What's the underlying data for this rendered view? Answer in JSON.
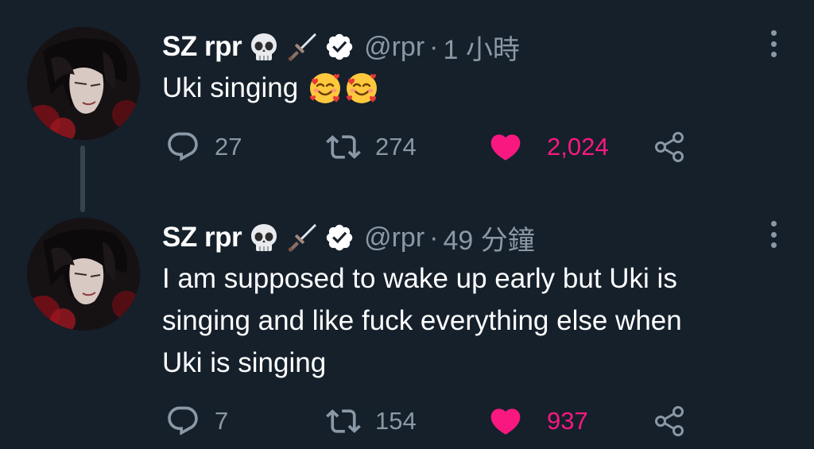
{
  "colors": {
    "background": "#15202b",
    "text_primary": "#ffffff",
    "text_secondary": "#8b98a5",
    "like_active": "#f91880",
    "thread_line": "#38444d"
  },
  "tweets": [
    {
      "display_name": "SZ rpr",
      "name_emojis": [
        "skull-emoji",
        "dagger-emoji"
      ],
      "verified": true,
      "handle": "@rpr",
      "separator": "·",
      "time": "1 小時",
      "text_lines": [
        "Uki singing"
      ],
      "text_emojis": [
        "smiling-face-with-hearts-emoji",
        "smiling-face-with-hearts-emoji"
      ],
      "reply_count": "27",
      "retweet_count": "274",
      "like_count": "2,024",
      "liked": true
    },
    {
      "display_name": "SZ rpr",
      "name_emojis": [
        "skull-emoji",
        "dagger-emoji"
      ],
      "verified": true,
      "handle": "@rpr",
      "separator": "·",
      "time": "49 分鐘",
      "text_lines": [
        "I am supposed to wake up early but Uki is",
        "singing and like fuck everything else when",
        "Uki is singing"
      ],
      "text_emojis": [],
      "reply_count": "7",
      "retweet_count": "154",
      "like_count": "937",
      "liked": true
    }
  ]
}
